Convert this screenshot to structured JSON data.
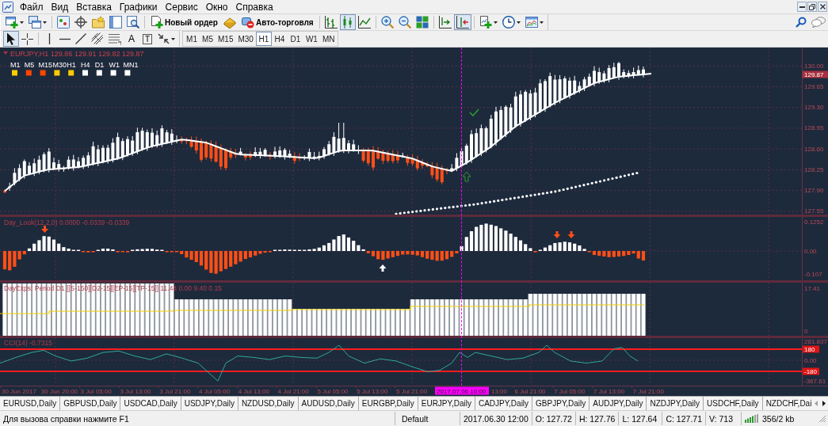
{
  "menu_bar": {
    "items": [
      "Файл",
      "Вид",
      "Вставка",
      "Графики",
      "Сервис",
      "Окно",
      "Справка"
    ]
  },
  "toolbar": {
    "new_order": "Новый ордер",
    "auto_trading": "Авто-торговля",
    "chart_types": [
      {
        "selected": false
      },
      {
        "selected": true
      },
      {
        "selected": false
      }
    ],
    "auto_scroll": {
      "on": false
    },
    "chart_shift": {
      "on": true
    }
  },
  "drawing_toolbar": {
    "tools": [
      {
        "selected": true
      },
      {
        "selected": false
      }
    ],
    "text_tools": [
      "A",
      "T"
    ],
    "periods": [
      {
        "label": "M1",
        "selected": false
      },
      {
        "label": "M5",
        "selected": false
      },
      {
        "label": "M15",
        "selected": false
      },
      {
        "label": "M30",
        "selected": false
      },
      {
        "label": "H1",
        "selected": true
      },
      {
        "label": "H4",
        "selected": false
      },
      {
        "label": "D1",
        "selected": false
      },
      {
        "label": "W1",
        "selected": false
      },
      {
        "label": "MN",
        "selected": false
      }
    ]
  },
  "chart": {
    "header": "EURJPY,H1  129.86 129.91 129.82 129.87",
    "timeframes": [
      {
        "label": "M1",
        "color": "#ffcc00"
      },
      {
        "label": "M5",
        "color": "#ff4500"
      },
      {
        "label": "M15",
        "color": "#ff4500"
      },
      {
        "label": "M30",
        "color": "#ffcc00"
      },
      {
        "label": "H1",
        "color": "#ffcc00"
      },
      {
        "label": "H4",
        "color": "#ffffff"
      },
      {
        "label": "D1",
        "color": "#ffffff"
      },
      {
        "label": "W1",
        "color": "#ffffff"
      },
      {
        "label": "MN1",
        "color": "#ffffff"
      }
    ],
    "price_axis": [
      "130.00",
      "129.65",
      "129.30",
      "128.95",
      "128.60",
      "128.25",
      "127.90",
      "127.55"
    ],
    "current_price": "129.87",
    "day_look": {
      "label": "Day_Look(12,2,0) 0.0000 -0.0339 -0.0339",
      "axis": [
        "0.1252",
        "0.00",
        "-0.107"
      ]
    },
    "day_exps": {
      "label": "DayExps: Period D1 [[S-150][D2-15][EP-15][TP-15]] 11.44 0.00 9.40 0.15",
      "axis": [
        "17.41",
        "0"
      ]
    },
    "cci": {
      "label": "CCI(14) -0.7315",
      "axis": [
        {
          "label": "281.837",
          "highlighted": false
        },
        {
          "label": "180",
          "highlighted": true
        },
        {
          "label": "0.00",
          "highlighted": false
        },
        {
          "label": "-180",
          "highlighted": true
        },
        {
          "label": "-367.61",
          "highlighted": false
        }
      ]
    },
    "time_axis": [
      "30 Jun 2017",
      "30 Jun 20:00",
      "3 Jul 05:00",
      "3 Jul 13:00",
      "3 Jul 21:00",
      "4 Jul 05:00",
      "4 Jul 13:00",
      "4 Jul 21:00",
      "5 Jul 05:00",
      "5 Jul 13:00",
      "5 Jul 21:00",
      "13:00",
      "6 Jul 21:00",
      "7 Jul 05:00",
      "7 Jul 13:00",
      "7 Jul 21:00"
    ],
    "cursor_time": "2017.07.06 10:00"
  },
  "tabs": [
    "EURUSD,Daily",
    "GBPUSD,Daily",
    "USDCAD,Daily",
    "USDJPY,Daily",
    "NZDUSD,Daily",
    "AUDUSD,Daily",
    "EURGBP,Daily",
    "EURJPY,Daily",
    "CADJPY,Daily",
    "GBPJPY,Daily",
    "AUDJPY,Daily",
    "NZDJPY,Daily",
    "USDCHF,Daily",
    "NZDCHF,Dai"
  ],
  "status_bar": {
    "help": "Для вызова справки нажмите F1",
    "profile": "Default",
    "time": "2017.06.30 12:00",
    "open": "O: 127.72",
    "high": "H: 127.76",
    "low": "L: 127.64",
    "close": "C: 127.71",
    "volume": "V: 713",
    "traffic": "356/2 kb"
  }
}
